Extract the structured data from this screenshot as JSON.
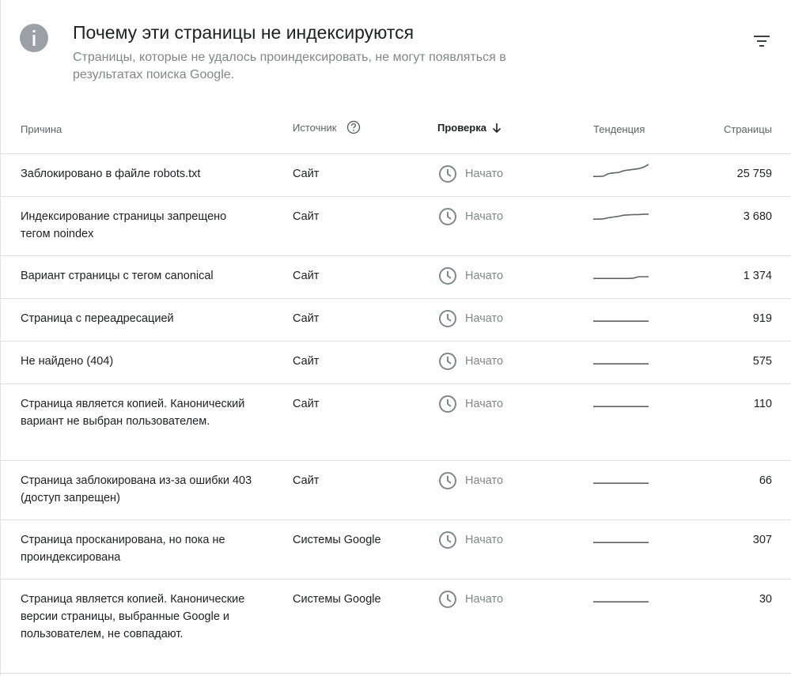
{
  "header": {
    "title": "Почему эти страницы не индексируются",
    "subtitle": "Страницы, которые не удалось проиндексировать, не могут появляться в результатах поиска Google.",
    "info_icon": "info-icon",
    "filter_icon": "filter-icon"
  },
  "columns": {
    "reason": "Причина",
    "source": "Источник",
    "check": "Проверка",
    "trend": "Тенденция",
    "pages": "Страницы"
  },
  "status_icon": "clock-icon",
  "rows": [
    {
      "reason": "Заблокировано в файле robots.txt",
      "source": "Сайт",
      "status": "Начато",
      "trend": [
        0.1,
        0.1,
        0.12,
        0.3,
        0.35,
        0.38,
        0.5,
        0.55,
        0.6,
        0.65,
        0.75,
        0.95
      ],
      "pages": "25 759"
    },
    {
      "reason": "Индексирование страницы запрещено тегом noindex",
      "source": "Сайт",
      "status": "Начато",
      "trend": [
        0.1,
        0.1,
        0.12,
        0.2,
        0.25,
        0.3,
        0.38,
        0.4,
        0.42,
        0.42,
        0.45,
        0.45
      ],
      "pages": "3 680"
    },
    {
      "reason": "Вариант страницы с тегом canonical",
      "source": "Сайт",
      "status": "Начато",
      "trend": [
        0.1,
        0.1,
        0.1,
        0.1,
        0.1,
        0.1,
        0.1,
        0.1,
        0.12,
        0.22,
        0.22,
        0.22
      ],
      "pages": "1 374"
    },
    {
      "reason": "Страница с переадресацией",
      "source": "Сайт",
      "status": "Начато",
      "trend": [
        0.1,
        0.1,
        0.1,
        0.1,
        0.1,
        0.1,
        0.1,
        0.1,
        0.1,
        0.1,
        0.1,
        0.1
      ],
      "pages": "919"
    },
    {
      "reason": "Не найдено (404)",
      "source": "Сайт",
      "status": "Начато",
      "trend": [
        0.1,
        0.1,
        0.1,
        0.1,
        0.1,
        0.1,
        0.1,
        0.1,
        0.1,
        0.1,
        0.1,
        0.1
      ],
      "pages": "575"
    },
    {
      "reason": "Страница является копией. Канонический вариант не выбран пользователем.",
      "source": "Сайт",
      "status": "Начато",
      "trend": [
        0.1,
        0.1,
        0.1,
        0.1,
        0.1,
        0.1,
        0.1,
        0.1,
        0.1,
        0.1,
        0.1,
        0.1
      ],
      "pages": "110"
    },
    {
      "reason": "Страница заблокирована из-за ошибки 403 (доступ запрещен)",
      "source": "Сайт",
      "status": "Начато",
      "trend": [
        0.1,
        0.1,
        0.1,
        0.1,
        0.1,
        0.1,
        0.1,
        0.1,
        0.1,
        0.1,
        0.1,
        0.1
      ],
      "pages": "66"
    },
    {
      "reason": "Страница просканирована, но пока не проиндексирована",
      "source": "Системы Google",
      "status": "Начато",
      "trend": [
        0.1,
        0.1,
        0.1,
        0.1,
        0.1,
        0.1,
        0.1,
        0.1,
        0.1,
        0.1,
        0.1,
        0.1
      ],
      "pages": "307"
    },
    {
      "reason": "Страница является копией. Канонические версии страницы, выбранные Google и пользователем, не совпадают.",
      "source": "Системы Google",
      "status": "Начато",
      "trend": [
        0.1,
        0.1,
        0.1,
        0.1,
        0.1,
        0.1,
        0.1,
        0.1,
        0.1,
        0.1,
        0.1,
        0.1
      ],
      "pages": "30"
    }
  ],
  "colors": {
    "icon_gray": "#9aa0a6",
    "muted_text": "#80868b",
    "trend_line": "#5f6368"
  }
}
